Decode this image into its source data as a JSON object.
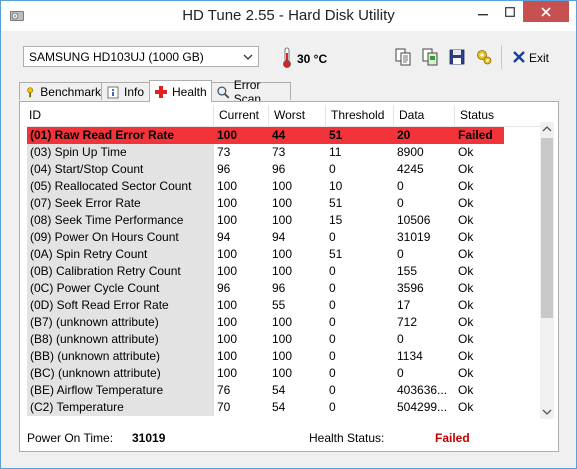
{
  "window": {
    "title": "HD Tune 2.55 - Hard Disk Utility"
  },
  "toolbar": {
    "drive": "SAMSUNG HD103UJ (1000 GB)",
    "temperature": "30 °C",
    "exit_label": "Exit",
    "icons": [
      "copy-text-icon",
      "copy-screenshot-icon",
      "save-icon",
      "options-icon"
    ]
  },
  "tabs": [
    {
      "label": "Benchmark",
      "icon": "benchmark-icon"
    },
    {
      "label": "Info",
      "icon": "info-icon"
    },
    {
      "label": "Health",
      "icon": "health-cross-icon",
      "active": true
    },
    {
      "label": "Error Scan",
      "icon": "magnifier-icon"
    }
  ],
  "table": {
    "headers": [
      "ID",
      "Current",
      "Worst",
      "Threshold",
      "Data",
      "Status"
    ],
    "rows": [
      [
        "(01) Raw Read Error Rate",
        "100",
        "44",
        "51",
        "20",
        "Failed"
      ],
      [
        "(03) Spin Up Time",
        "73",
        "73",
        "11",
        "8900",
        "Ok"
      ],
      [
        "(04) Start/Stop Count",
        "96",
        "96",
        "0",
        "4245",
        "Ok"
      ],
      [
        "(05) Reallocated Sector Count",
        "100",
        "100",
        "10",
        "0",
        "Ok"
      ],
      [
        "(07) Seek Error Rate",
        "100",
        "100",
        "51",
        "0",
        "Ok"
      ],
      [
        "(08) Seek Time Performance",
        "100",
        "100",
        "15",
        "10506",
        "Ok"
      ],
      [
        "(09) Power On Hours Count",
        "94",
        "94",
        "0",
        "31019",
        "Ok"
      ],
      [
        "(0A) Spin Retry Count",
        "100",
        "100",
        "51",
        "0",
        "Ok"
      ],
      [
        "(0B) Calibration Retry Count",
        "100",
        "100",
        "0",
        "155",
        "Ok"
      ],
      [
        "(0C) Power Cycle Count",
        "96",
        "96",
        "0",
        "3596",
        "Ok"
      ],
      [
        "(0D) Soft Read Error Rate",
        "100",
        "55",
        "0",
        "17",
        "Ok"
      ],
      [
        "(B7) (unknown attribute)",
        "100",
        "100",
        "0",
        "712",
        "Ok"
      ],
      [
        "(B8) (unknown attribute)",
        "100",
        "100",
        "0",
        "0",
        "Ok"
      ],
      [
        "(BB) (unknown attribute)",
        "100",
        "100",
        "0",
        "1134",
        "Ok"
      ],
      [
        "(BC) (unknown attribute)",
        "100",
        "100",
        "0",
        "0",
        "Ok"
      ],
      [
        "(BE) Airflow Temperature",
        "76",
        "54",
        "0",
        "403636...",
        "Ok"
      ],
      [
        "(C2) Temperature",
        "70",
        "54",
        "0",
        "504299...",
        "Ok"
      ]
    ],
    "failed_row_color": "#f2343a"
  },
  "footer": {
    "power_on_label": "Power On Time:",
    "power_on_value": "31019",
    "health_label": "Health Status:",
    "health_value": "Failed",
    "health_color": "#c00000"
  }
}
